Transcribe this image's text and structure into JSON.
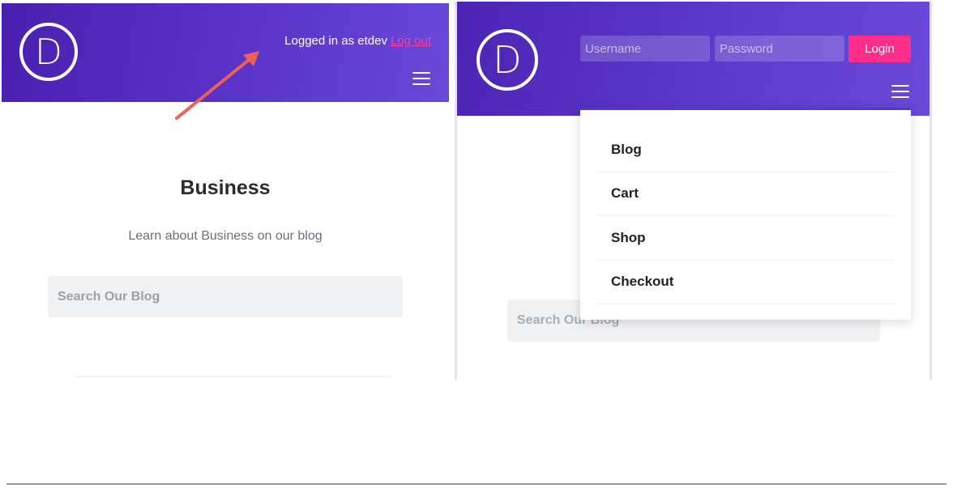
{
  "left": {
    "logo_letter": "D",
    "logged_in_text": "Logged in as etdev",
    "logout_label": "Log out",
    "title": "Business",
    "subtitle": "Learn about Business on our blog",
    "search_placeholder": "Search Our Blog"
  },
  "right": {
    "logo_letter": "D",
    "username_placeholder": "Username",
    "password_placeholder": "Password",
    "login_label": "Login",
    "menu_items": [
      "Blog",
      "Cart",
      "Shop",
      "Checkout"
    ],
    "search_placeholder": "Search Our Blog"
  },
  "colors": {
    "header_start": "#4a1fb0",
    "header_end": "#6a48d8",
    "accent_pink": "#ff2e8b",
    "arrow": "#f0605a"
  },
  "icons": {
    "menu": "hamburger-icon",
    "annotation": "arrow-icon"
  }
}
